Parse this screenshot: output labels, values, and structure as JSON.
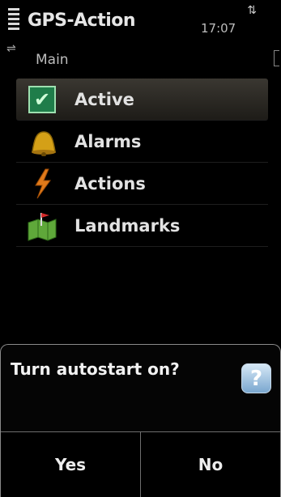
{
  "statusbar": {
    "title": "GPS-Action",
    "time": "17:07",
    "signal_icon": "signal-strength-icon",
    "network_icon": "network-activity-icon"
  },
  "header": {
    "subtitle": "Main"
  },
  "menu": {
    "items": [
      {
        "label": "Active",
        "icon": "checkbox-checked-icon",
        "selected": true
      },
      {
        "label": "Alarms",
        "icon": "bell-icon"
      },
      {
        "label": "Actions",
        "icon": "lightning-icon"
      },
      {
        "label": "Landmarks",
        "icon": "map-flag-icon"
      }
    ]
  },
  "dialog": {
    "text": "Turn autostart on?",
    "icon": "help-icon",
    "buttons": {
      "yes": "Yes",
      "no": "No"
    }
  },
  "colors": {
    "background": "#000000",
    "selected_row": "#3a3731",
    "check_green": "#1f7d4a",
    "help_blue": "#7aa7cf"
  }
}
